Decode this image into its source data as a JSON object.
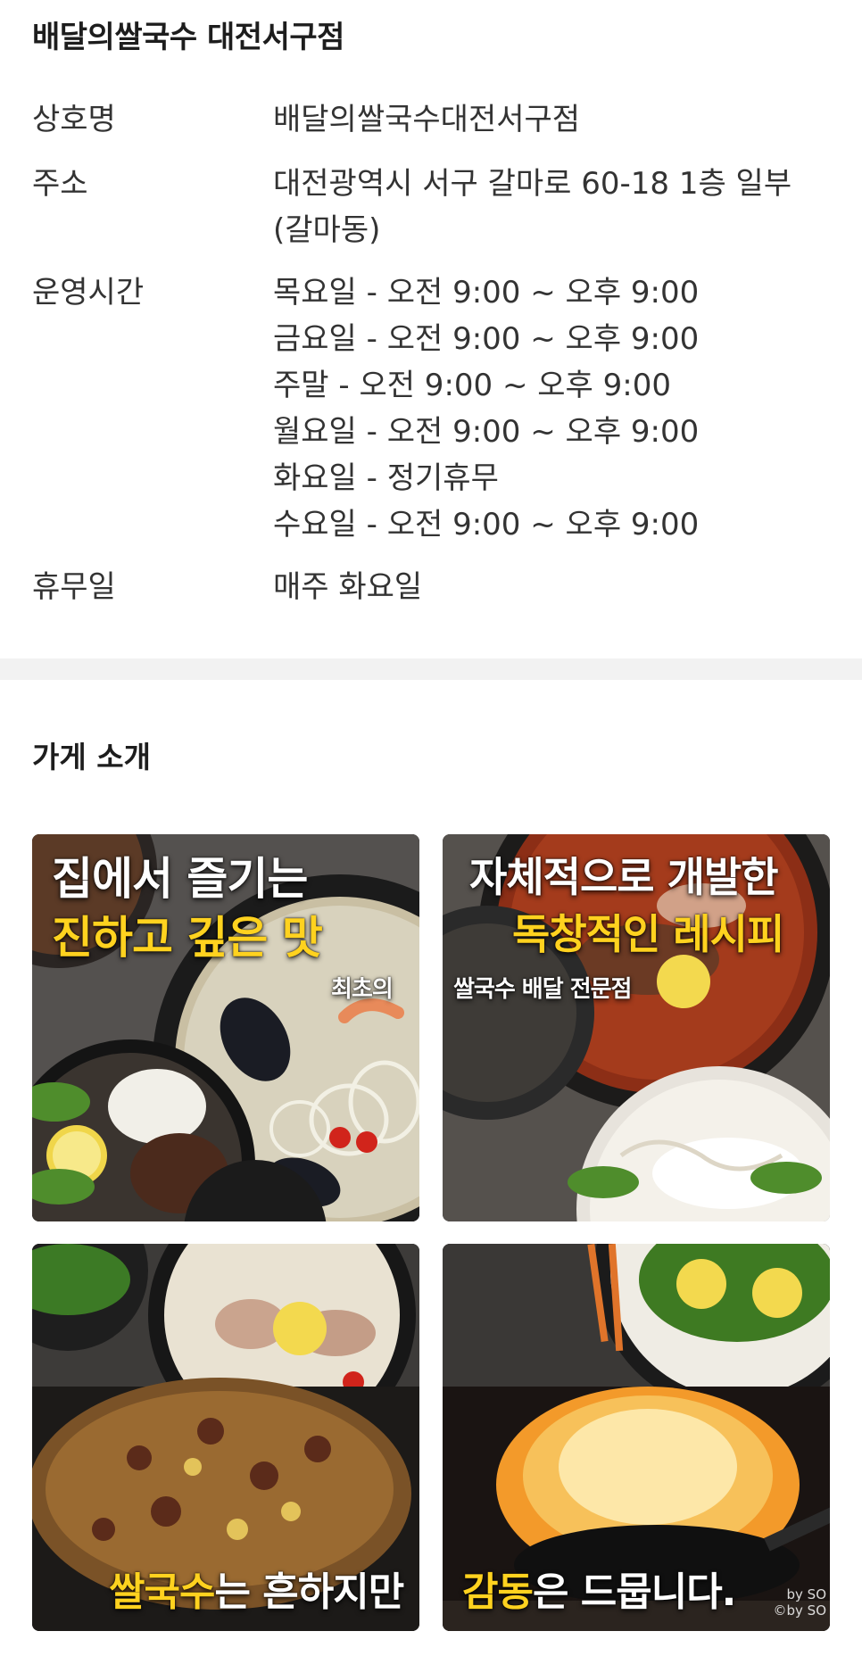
{
  "store": {
    "title": "배달의쌀국수 대전서구점"
  },
  "info": {
    "name_label": "상호명",
    "name_value": "배달의쌀국수대전서구점",
    "address_label": "주소",
    "address_line1": "대전광역시 서구 갈마로 60-18 1층 일부",
    "address_line2": "(갈마동)",
    "hours_label": "운영시간",
    "hours": [
      "목요일 - 오전 9:00 ~ 오후 9:00",
      "금요일 - 오전 9:00 ~ 오후 9:00",
      "주말 - 오전 9:00 ~ 오후 9:00",
      "월요일 - 오전 9:00 ~ 오후 9:00",
      "화요일 - 정기휴무",
      "수요일 - 오전 9:00 ~ 오후 9:00"
    ],
    "closed_label": "휴무일",
    "closed_value": "매주 화요일"
  },
  "intro": {
    "title": "가게 소개",
    "tiles": [
      {
        "line1": "집에서 즐기는",
        "line2": "진하고 깊은 맛",
        "tag": "최초의"
      },
      {
        "line1": "자체적으로 개발한",
        "line2": "독창적인 레시피",
        "tag": "쌀국수 배달 전문점"
      },
      {
        "highlight": "쌀국수",
        "rest": "는 흔하지만"
      },
      {
        "highlight": "감동",
        "rest": "은 드뭅니다.",
        "watermark1": "by SO",
        "watermark2": "©by SO"
      }
    ]
  },
  "colors": {
    "caption_yellow": "#ffd21f",
    "divider": "#f2f2f2"
  }
}
